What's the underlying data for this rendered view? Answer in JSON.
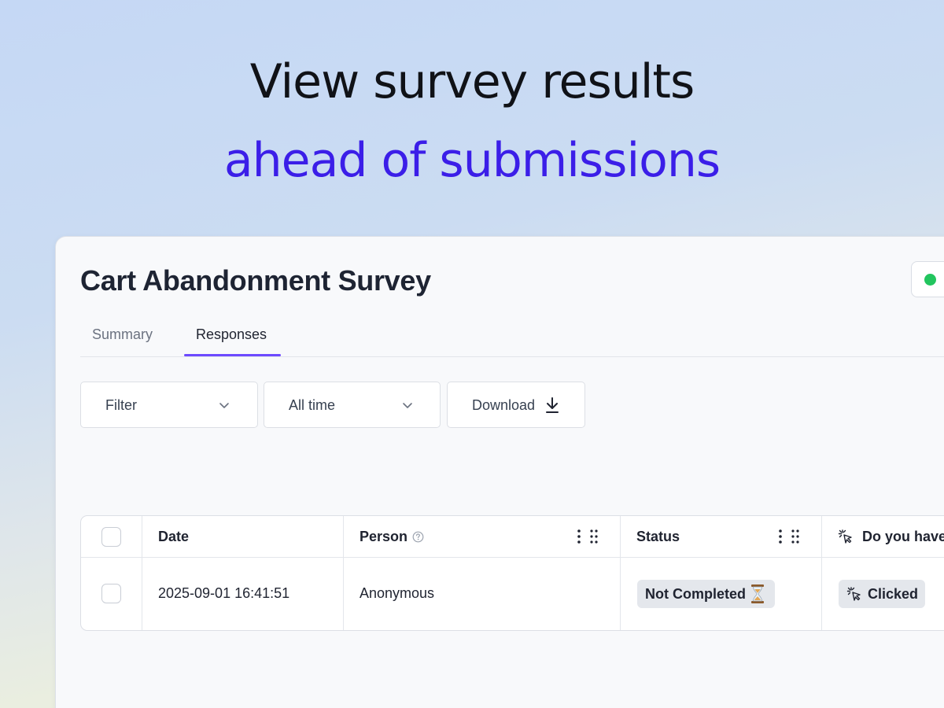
{
  "hero": {
    "line1": "View survey results",
    "line2": "ahead of submissions"
  },
  "survey": {
    "title": "Cart Abandonment Survey",
    "status_color": "#22c55e"
  },
  "tabs": [
    {
      "label": "Summary",
      "active": false
    },
    {
      "label": "Responses",
      "active": true
    }
  ],
  "toolbar": {
    "filter_label": "Filter",
    "time_label": "All time",
    "download_label": "Download"
  },
  "table": {
    "headers": {
      "date": "Date",
      "person": "Person",
      "status": "Status",
      "question": "Do you have"
    },
    "rows": [
      {
        "date": "2025-09-01 16:41:51",
        "person": "Anonymous",
        "status": "Not Completed",
        "question": "Clicked"
      }
    ]
  },
  "colors": {
    "accent": "#6d4aff",
    "headline_accent": "#3b1ee8",
    "live_dot": "#22c55e"
  },
  "icons": [
    "chevron-down-icon",
    "download-icon",
    "help-icon",
    "kebab-icon",
    "drag-handle-icon",
    "click-icon",
    "hourglass-icon"
  ]
}
